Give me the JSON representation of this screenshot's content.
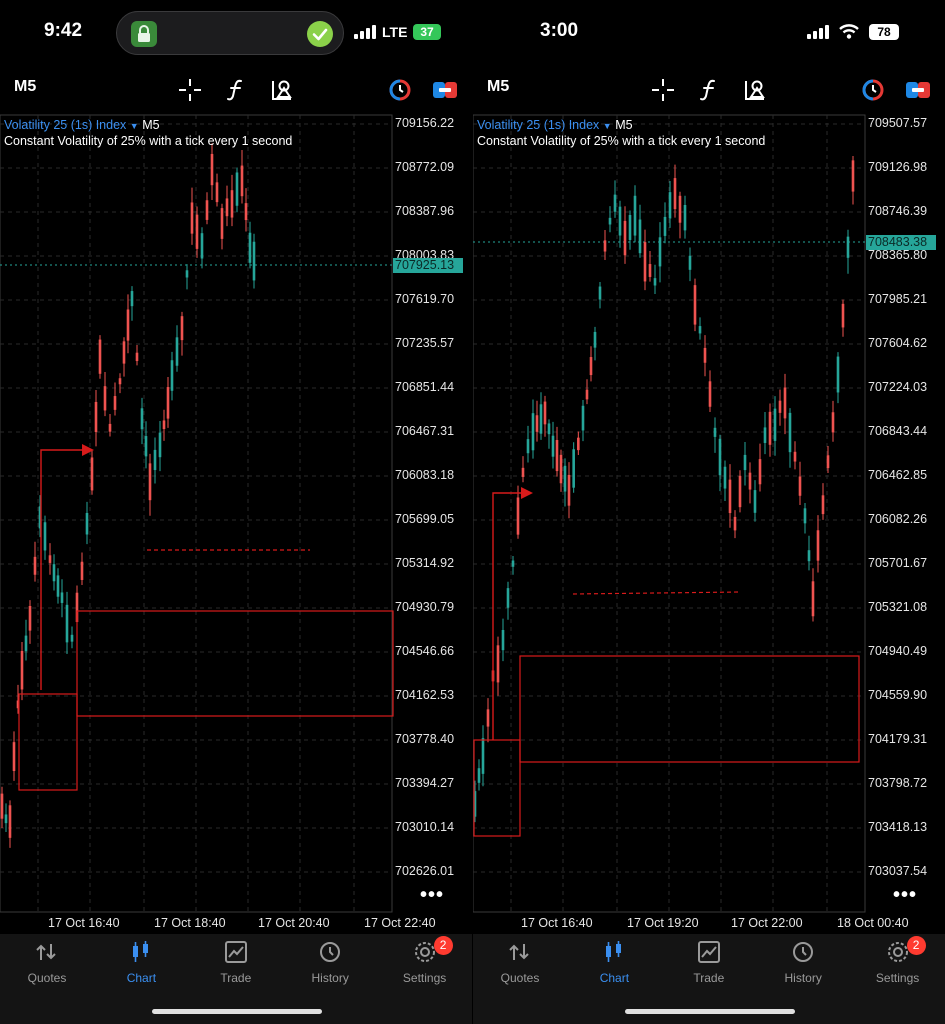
{
  "colors": {
    "bull": "#26a69a",
    "bear": "#ef5350",
    "accent": "#3b8ff0",
    "annotation": "#d81b1b",
    "grid": "#2a2a2a"
  },
  "left": {
    "status": {
      "time": "9:42",
      "network": "LTE",
      "battery": "37"
    },
    "toolbar": {
      "timeframe": "M5",
      "icons": [
        "crosshair-icon",
        "function-icon",
        "objects-icon",
        "color-toggle-icon",
        "chart-type-icon"
      ]
    },
    "header": {
      "symbol": "Volatility 25 (1s) Index",
      "timeframe": "M5",
      "description": "Constant Volatility of 25% with a tick every 1 second"
    },
    "price_axis": [
      "709156.22",
      "708772.09",
      "708387.96",
      "708003.83",
      "707619.70",
      "707235.57",
      "706851.44",
      "706467.31",
      "706083.18",
      "705699.05",
      "705314.92",
      "704930.79",
      "704546.66",
      "704162.53",
      "703778.40",
      "703394.27",
      "703010.14",
      "702626.01"
    ],
    "current_price": "707925.13",
    "time_axis": [
      "17 Oct 16:40",
      "17 Oct 18:40",
      "17 Oct 20:40",
      "17 Oct 22:40"
    ],
    "more": "•••"
  },
  "right": {
    "status": {
      "time": "3:00",
      "battery": "78"
    },
    "toolbar": {
      "timeframe": "M5",
      "icons": [
        "crosshair-icon",
        "function-icon",
        "objects-icon",
        "color-toggle-icon",
        "chart-type-icon"
      ]
    },
    "header": {
      "symbol": "Volatility 25 (1s) Index",
      "timeframe": "M5",
      "description": "Constant Volatility of 25% with a tick every 1 second"
    },
    "price_axis": [
      "709507.57",
      "709126.98",
      "708746.39",
      "708365.80",
      "707985.21",
      "707604.62",
      "707224.03",
      "706843.44",
      "706462.85",
      "706082.26",
      "705701.67",
      "705321.08",
      "704940.49",
      "704559.90",
      "704179.31",
      "703798.72",
      "703418.13",
      "703037.54"
    ],
    "current_price": "708483.38",
    "time_axis": [
      "17 Oct 16:40",
      "17 Oct 19:20",
      "17 Oct 22:00",
      "18 Oct 00:40"
    ],
    "more": "•••"
  },
  "tabs": [
    {
      "label": "Quotes",
      "icon": "quotes-icon"
    },
    {
      "label": "Chart",
      "icon": "chart-icon",
      "active": true
    },
    {
      "label": "Trade",
      "icon": "trade-icon"
    },
    {
      "label": "History",
      "icon": "history-icon"
    },
    {
      "label": "Settings",
      "icon": "settings-icon",
      "badge": "2"
    }
  ]
}
